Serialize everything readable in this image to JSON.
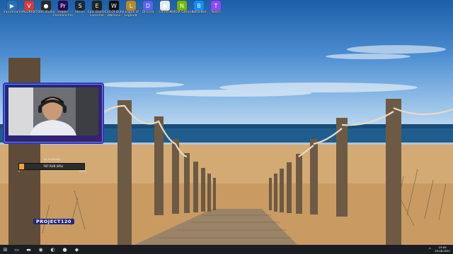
{
  "desktop_icons": [
    {
      "label": "mpcstream",
      "icon": "app-icon",
      "color": "#2c6fb8"
    },
    {
      "label": "VALORANT",
      "icon": "valorant-icon",
      "color": "#d23b3b"
    },
    {
      "label": "OBS Studio",
      "icon": "obs-icon",
      "color": "#2a2a2a"
    },
    {
      "label": "Adobe\nPremiere Pro",
      "icon": "premiere-icon",
      "color": "#2a0a55"
    },
    {
      "label": "Steam",
      "icon": "steam-icon",
      "color": "#1b2838"
    },
    {
      "label": "Epic Games\nLauncher",
      "icon": "epic-icon",
      "color": "#222222"
    },
    {
      "label": "Call Of Duty\nWarzone",
      "icon": "cod-icon",
      "color": "#111111"
    },
    {
      "label": "League of\nLegends",
      "icon": "lol-icon",
      "color": "#b58a2b"
    },
    {
      "label": "Discord",
      "icon": "discord-icon",
      "color": "#5865f2"
    },
    {
      "label": "Chrome",
      "icon": "chrome-icon",
      "color": "#e8e8e8"
    },
    {
      "label": "NVIDIA GeForce",
      "icon": "nvidia-icon",
      "color": "#76b900"
    },
    {
      "label": "BattleNet",
      "icon": "battlenet-icon",
      "color": "#148eff"
    },
    {
      "label": "Twitch",
      "icon": "twitch-icon",
      "color": "#9146ff"
    }
  ],
  "colors": {
    "taskbar": "#1b1d22",
    "progress_fill": "#f2a23a",
    "webcam_frame": "#2d3bb0"
  },
  "webcam": {
    "label": "PROJECT120"
  },
  "stream_overlay": {
    "title": "ЗА ПОМОЩЬ",
    "progress_text": "787 RUB (8%)",
    "progress": 0.08,
    "min": "0",
    "max": "10000"
  },
  "taskbar": {
    "items": [
      {
        "name": "start-button",
        "icon": "windows-icon",
        "glyph": "⊞"
      },
      {
        "name": "task-view-button",
        "icon": "task-view-icon",
        "glyph": "▭"
      },
      {
        "name": "file-explorer-button",
        "icon": "folder-icon",
        "glyph": "▬"
      },
      {
        "name": "chrome-taskbar-button",
        "icon": "chrome-icon",
        "glyph": "◉"
      },
      {
        "name": "edge-taskbar-button",
        "icon": "edge-icon",
        "glyph": "◐"
      },
      {
        "name": "obs-taskbar-button",
        "icon": "obs-icon",
        "glyph": "●"
      },
      {
        "name": "discord-taskbar-button",
        "icon": "discord-icon",
        "glyph": "◆"
      }
    ],
    "clock_time": "23:09",
    "clock_date": "29.06.2021"
  }
}
